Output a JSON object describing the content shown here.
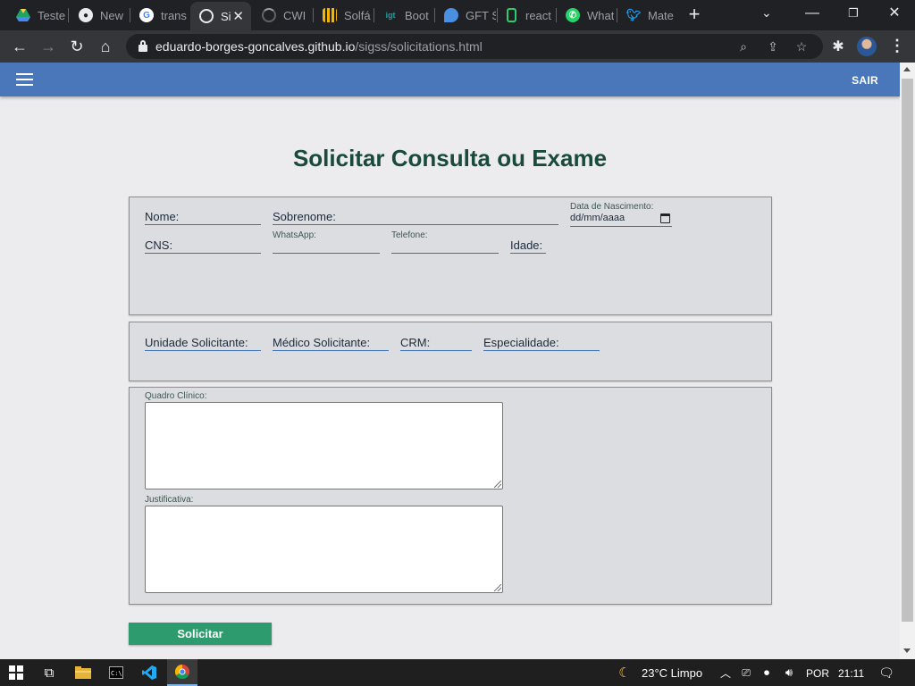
{
  "browser": {
    "tabs": [
      {
        "label": "Teste",
        "icon": "google-drive-icon",
        "color": "#1fa463"
      },
      {
        "label": "New",
        "icon": "github-icon",
        "color": "#e8eaed"
      },
      {
        "label": "trans",
        "icon": "google-icon",
        "color": "#4285f4"
      },
      {
        "label": "Si",
        "icon": "globe-icon",
        "color": "#e8eaed",
        "active": true
      },
      {
        "label": "CWI",
        "icon": "loading-icon",
        "color": "#5f6368"
      },
      {
        "label": "Solfá",
        "icon": "grid-icon",
        "color": "#f4b400"
      },
      {
        "label": "Boot",
        "icon": "igt-icon",
        "color": "#1aa1a1"
      },
      {
        "label": "GFT S",
        "icon": "drop-icon",
        "color": "#4a90e2"
      },
      {
        "label": "react",
        "icon": "phone-icon",
        "color": "#2ecc71"
      },
      {
        "label": "What",
        "icon": "whatsapp-icon",
        "color": "#25d366"
      },
      {
        "label": "Mate",
        "icon": "twitter-icon",
        "color": "#1da1f2"
      }
    ],
    "url_host": "eduardo-borges-goncalves.github.io",
    "url_path": "/sigss/solicitations.html"
  },
  "app": {
    "logout_label": "SAIR",
    "page_title": "Solicitar Consulta ou Exame",
    "patient": {
      "nome": "Nome:",
      "sobrenome": "Sobrenome:",
      "data_nascimento_label": "Data de Nascimento:",
      "data_nascimento_placeholder": "dd/mm/aaaa",
      "cns": "CNS:",
      "whatsapp_label": "WhatsApp:",
      "telefone_label": "Telefone:",
      "idade": "Idade:"
    },
    "requester": {
      "unidade": "Unidade Solicitante:",
      "medico": "Médico Solicitante:",
      "crm": "CRM:",
      "especialidade": "Especialidade:"
    },
    "clinical": {
      "quadro_label": "Quadro Clínico:",
      "justificativa_label": "Justificativa:"
    },
    "submit_label": "Solicitar"
  },
  "taskbar": {
    "weather": "23°C  Limpo",
    "language": "POR",
    "time": "21:11"
  }
}
